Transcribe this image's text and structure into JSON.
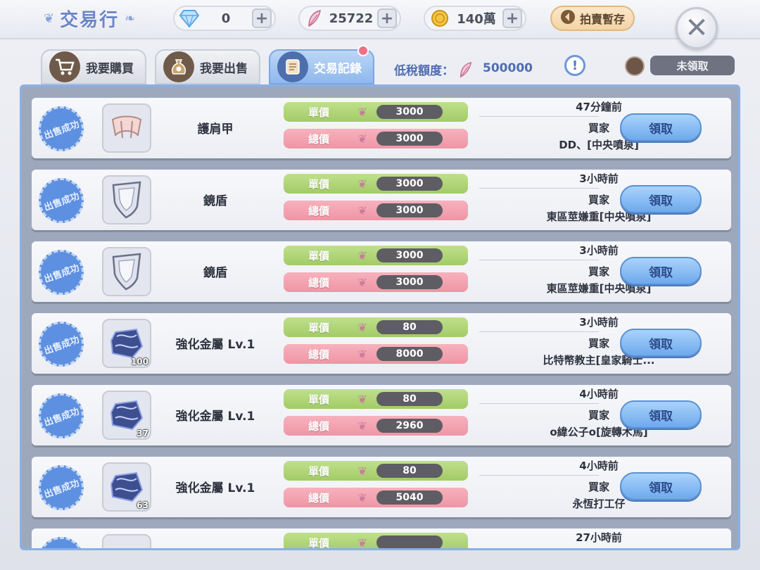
{
  "header": {
    "title": "交易行",
    "diamond": "0",
    "crystal": "25722",
    "zeny": "140萬",
    "auction_storage": "拍賣暫存"
  },
  "tabs": [
    {
      "label": "我要購買",
      "icon": "shopping-cart-icon"
    },
    {
      "label": "我要出售",
      "icon": "money-bag-icon"
    },
    {
      "label": "交易記錄",
      "icon": "scroll-icon",
      "active": true
    }
  ],
  "tax": {
    "label": "低稅額度：",
    "value": "500000"
  },
  "unclaimed_label": "未領取",
  "labels": {
    "stamp": "出售成功",
    "unit_price": "單價",
    "total_price": "總價",
    "buyer": "買家",
    "claim": "領取"
  },
  "records": [
    {
      "name": "護肩甲",
      "icon": "shoulder-armor-icon",
      "qty": "",
      "unit": "3000",
      "total": "3000",
      "time": "47分鐘前",
      "buyer": "DD、[中央噴泉]"
    },
    {
      "name": "鏡盾",
      "icon": "mirror-shield-icon",
      "qty": "",
      "unit": "3000",
      "total": "3000",
      "time": "3小時前",
      "buyer": "東區莖嫌重[中央噴泉]"
    },
    {
      "name": "鏡盾",
      "icon": "mirror-shield-icon",
      "qty": "",
      "unit": "3000",
      "total": "3000",
      "time": "3小時前",
      "buyer": "東區莖嫌重[中央噴泉]"
    },
    {
      "name": "強化金屬 Lv.1",
      "icon": "enhance-metal-icon",
      "qty": "100",
      "unit": "80",
      "total": "8000",
      "time": "3小時前",
      "buyer": "比特幣教主[皇家騎士..."
    },
    {
      "name": "強化金屬 Lv.1",
      "icon": "enhance-metal-icon",
      "qty": "37",
      "unit": "80",
      "total": "2960",
      "time": "4小時前",
      "buyer": "o緯公子o[旋轉木馬]"
    },
    {
      "name": "強化金屬 Lv.1",
      "icon": "enhance-metal-icon",
      "qty": "63",
      "unit": "80",
      "total": "5040",
      "time": "4小時前",
      "buyer": "永恆打工仔"
    },
    {
      "name": "",
      "icon": "",
      "qty": "",
      "unit": "",
      "total": "",
      "time": "27小時前",
      "buyer": ""
    }
  ]
}
